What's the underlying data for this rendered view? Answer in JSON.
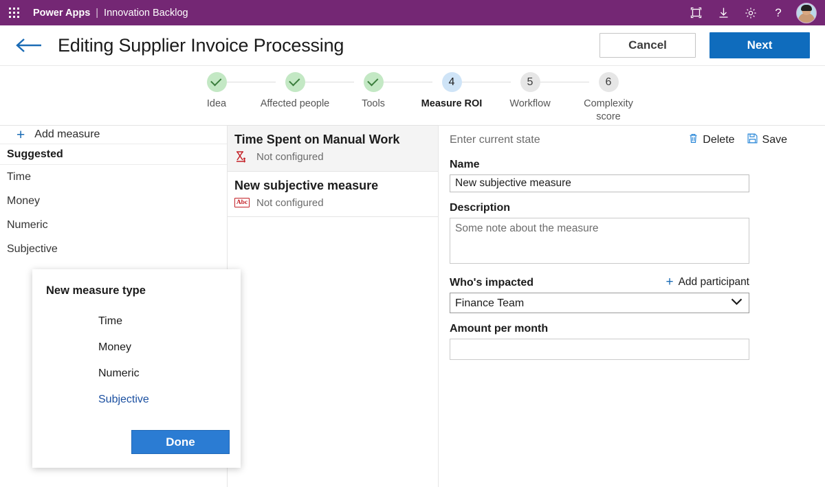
{
  "suite_bar": {
    "waffle_icon": "app-launcher-icon",
    "brand_main": "Power Apps",
    "brand_separator": "|",
    "brand_sub": "Innovation Backlog",
    "actions": [
      {
        "name": "fullscreen-icon",
        "label": "Fullscreen"
      },
      {
        "name": "download-icon",
        "label": "Download"
      },
      {
        "name": "gear-icon",
        "label": "Settings"
      },
      {
        "name": "help-icon",
        "label": "Help"
      }
    ],
    "avatar_name": "avatar",
    "brand_color": "#742774"
  },
  "header": {
    "back_icon": "back-arrow-icon",
    "title": "Editing Supplier Invoice Processing",
    "cancel_label": "Cancel",
    "next_label": "Next",
    "accent_color": "#0f6cbd"
  },
  "stepper": {
    "steps": [
      {
        "number": "1",
        "label": "Idea",
        "state": "done"
      },
      {
        "number": "2",
        "label": "Affected people",
        "state": "done"
      },
      {
        "number": "3",
        "label": "Tools",
        "state": "done"
      },
      {
        "number": "4",
        "label": "Measure ROI",
        "state": "active"
      },
      {
        "number": "5",
        "label": "Workflow",
        "state": "upcoming"
      },
      {
        "number": "6",
        "label": "Complexity score",
        "state": "upcoming"
      }
    ]
  },
  "left_pane": {
    "add_measure_label": "Add measure",
    "add_icon": "plus-icon",
    "section_header": "Suggested",
    "items": [
      {
        "label": "Time"
      },
      {
        "label": "Money"
      },
      {
        "label": "Numeric"
      },
      {
        "label": "Subjective"
      }
    ]
  },
  "mid_pane": {
    "measures": [
      {
        "title": "Time Spent on Manual Work",
        "status": "Not configured",
        "icon": "hourglass-money-icon",
        "selected": true
      },
      {
        "title": "New subjective measure",
        "status": "Not configured",
        "icon": "abc-icon",
        "icon_text": "Abc",
        "selected": false
      }
    ]
  },
  "right_pane": {
    "state_label": "Enter current state",
    "delete_label": "Delete",
    "delete_icon": "trash-icon",
    "save_label": "Save",
    "save_icon": "save-disk-icon",
    "name_label": "Name",
    "name_value": "New subjective measure",
    "description_label": "Description",
    "description_value": "",
    "description_placeholder": "Some note about the measure",
    "impacted_label": "Who's impacted",
    "add_participant_label": "Add participant",
    "add_participant_icon": "plus-icon",
    "participant_value": "Finance Team",
    "participant_chevron": "chevron-down-icon",
    "amount_label": "Amount per month",
    "amount_value": "",
    "amount_placeholder": ""
  },
  "modal": {
    "title": "New measure type",
    "options": [
      {
        "label": "Time",
        "selected": false
      },
      {
        "label": "Money",
        "selected": false
      },
      {
        "label": "Numeric",
        "selected": false
      },
      {
        "label": "Subjective",
        "selected": true
      }
    ],
    "done_label": "Done",
    "done_color": "#2b7cd3"
  }
}
